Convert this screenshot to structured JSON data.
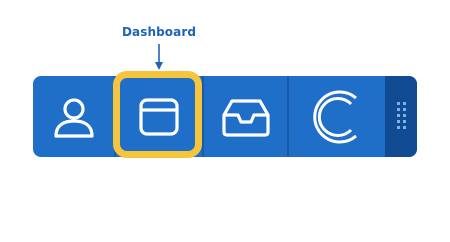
{
  "callout": {
    "label": "Dashboard"
  },
  "toolbar": {
    "items": [
      {
        "name": "user",
        "icon": "user-icon"
      },
      {
        "name": "dashboard",
        "icon": "window-icon",
        "highlighted": true
      },
      {
        "name": "inbox",
        "icon": "inbox-tray-icon"
      },
      {
        "name": "brand",
        "icon": "c-logo-icon"
      }
    ],
    "handle_icon": "grip-dots-icon"
  },
  "colors": {
    "toolbar_bg": "#1f6fc9",
    "handle_bg": "#114b94",
    "highlight": "#f6c53c",
    "callout_text": "#1f63b8"
  }
}
